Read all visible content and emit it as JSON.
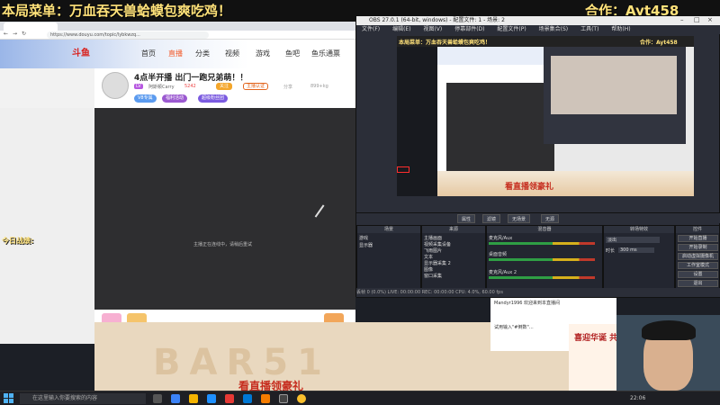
{
  "banner": {
    "left": "本局菜单：万血吞天兽蛤蟆包爽吃鸡！",
    "right": "合作：Ayt458"
  },
  "browser": {
    "url": "https://www.douyu.com/topic/lybkwzq...",
    "nav": [
      "首页",
      "直播",
      "分类",
      "视频",
      "游戏",
      "鱼吧",
      "鱼乐通票"
    ],
    "room_title": "4点半开播 出门一跑兄弟萌！！",
    "anchor": "阿斯顿Carry",
    "fans": "5242",
    "follow": "关注",
    "verify": "主播认证",
    "share": "分享",
    "fan_count": "899+kg",
    "pills": [
      "V8专属",
      "福利活动",
      "超级粉丝团"
    ],
    "video_msg": "主播正在连线中，请稍后重试",
    "today_label": "今日战绩:"
  },
  "obs": {
    "title": "OBS 27.0.1 (64-bit, windows) - 配置文件: 1 - 场景: 2",
    "menu": [
      "文件(F)",
      "编辑(E)",
      "视图(V)",
      "停靠部件(D)",
      "配置文件(P)",
      "场景集合(S)",
      "工具(T)",
      "帮助(H)"
    ],
    "preview_banner_left": "本局菜单：万血吞天兽蛤蟆包爽吃鸡！",
    "preview_banner_right": "合作：Ayt458",
    "preview_bottom": "看直播领豪礼",
    "toolbar": [
      "属性",
      "滤镜",
      "无场景",
      "无源"
    ],
    "docks": {
      "scenes": {
        "title": "场景",
        "items": [
          "游戏",
          "显示器"
        ]
      },
      "sources": {
        "title": "来源",
        "items": [
          "主播画面",
          "视频采集设备",
          "飞雨图片",
          "文本",
          "显示器采集 2",
          "图像",
          "窗口采集"
        ]
      },
      "mixer": {
        "title": "混音器",
        "items": [
          "麦克风/Aux",
          "桌面音频",
          "麦克风/Aux 2"
        ]
      },
      "trans": {
        "title": "转场特效",
        "item": "淡出",
        "duration_label": "时长",
        "duration": "300 ms"
      },
      "controls": {
        "title": "控件",
        "items": [
          "开始直播",
          "开始录制",
          "启动虚拟摄像机",
          "工作室模式",
          "设置",
          "退出"
        ]
      }
    },
    "status": "丢帧 0 (0.0%)   LIVE: 00:00:00   REC: 00:00:00   CPU: 4.0%, 60.00 fps"
  },
  "lower": {
    "big": "BAR51",
    "text": "看直播领豪礼",
    "couplet": "喜迎华诞 共庆周年"
  },
  "chat": {
    "line1": "Mandyr1996 欢迎来到本直播间",
    "line2": "试用输入\"#倒数\"…"
  },
  "taskbar": {
    "search": "在这里输入你要搜索的内容",
    "tray": "22:06"
  }
}
